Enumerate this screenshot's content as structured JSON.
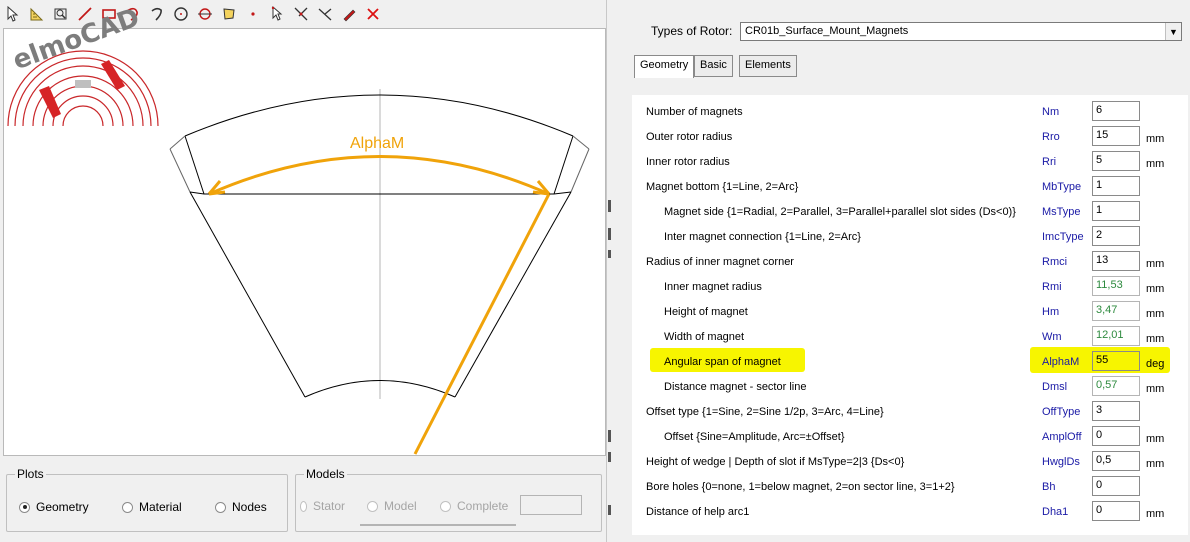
{
  "toolbar": {
    "icons": [
      "select-arrow-icon",
      "ruler-icon",
      "zoom-icon",
      "line-icon",
      "rectangle-icon",
      "arc-icon",
      "arc-reverse-icon",
      "circle-icon",
      "circle-point-icon",
      "polygon-icon",
      "point-icon",
      "pointer-icon",
      "multi-select-icon",
      "split-line-icon",
      "pencil-icon",
      "delete-x-icon"
    ]
  },
  "logo": {
    "text": "elmoCAD"
  },
  "geometry": {
    "annotation": "AlphaM",
    "accent_color": "#f0a30a"
  },
  "plots": {
    "title": "Plots",
    "options": [
      {
        "label": "Geometry",
        "selected": true
      },
      {
        "label": "Material",
        "selected": false
      },
      {
        "label": "Nodes",
        "selected": false
      }
    ]
  },
  "models": {
    "title": "Models",
    "options": [
      {
        "label": "Stator"
      },
      {
        "label": "Model"
      },
      {
        "label": "Complete"
      }
    ],
    "field_value": ""
  },
  "rotor": {
    "label": "Types of Rotor:",
    "selected": "CR01b_Surface_Mount_Magnets"
  },
  "tabs": [
    "Geometry",
    "Basic",
    "Elements"
  ],
  "parameters": [
    {
      "label": "Number of magnets",
      "sym": "Nm",
      "value": "6",
      "unit": "",
      "indent": false,
      "calc": false
    },
    {
      "label": "Outer rotor radius",
      "sym": "Rro",
      "value": "15",
      "unit": "mm",
      "indent": false,
      "calc": false
    },
    {
      "label": "Inner rotor radius",
      "sym": "Rri",
      "value": "5",
      "unit": "mm",
      "indent": false,
      "calc": false
    },
    {
      "label": "Magnet bottom {1=Line, 2=Arc}",
      "sym": "MbType",
      "value": "1",
      "unit": "",
      "indent": false,
      "calc": false
    },
    {
      "label": "Magnet side {1=Radial, 2=Parallel, 3=Parallel+parallel slot sides (Ds<0)}",
      "sym": "MsType",
      "value": "1",
      "unit": "",
      "indent": true,
      "calc": false
    },
    {
      "label": "Inter magnet connection {1=Line, 2=Arc}",
      "sym": "ImcType",
      "value": "2",
      "unit": "",
      "indent": true,
      "calc": false
    },
    {
      "label": "Radius of inner magnet corner",
      "sym": "Rmci",
      "value": "13",
      "unit": "mm",
      "indent": false,
      "calc": false
    },
    {
      "label": "Inner magnet radius",
      "sym": "Rmi",
      "value": "11,53",
      "unit": "mm",
      "indent": true,
      "calc": true
    },
    {
      "label": "Height of magnet",
      "sym": "Hm",
      "value": "3,47",
      "unit": "mm",
      "indent": true,
      "calc": true
    },
    {
      "label": "Width of magnet",
      "sym": "Wm",
      "value": "12,01",
      "unit": "mm",
      "indent": true,
      "calc": true
    },
    {
      "label": "Angular span of magnet",
      "sym": "AlphaM",
      "value": "55",
      "unit": "deg",
      "indent": true,
      "calc": false,
      "highlight": true
    },
    {
      "label": "Distance magnet - sector line",
      "sym": "Dmsl",
      "value": "0,57",
      "unit": "mm",
      "indent": true,
      "calc": true
    },
    {
      "label": "Offset type {1=Sine, 2=Sine 1/2p, 3=Arc, 4=Line}",
      "sym": "OffType",
      "value": "3",
      "unit": "",
      "indent": false,
      "calc": false
    },
    {
      "label": "Offset {Sine=Amplitude, Arc=±Offset}",
      "sym": "AmplOff",
      "value": "0",
      "unit": "mm",
      "indent": true,
      "calc": false
    },
    {
      "label": "Height of wedge | Depth of slot if MsType=2|3 {Ds<0}",
      "sym": "HwglDs",
      "value": "0,5",
      "unit": "mm",
      "indent": false,
      "calc": false
    },
    {
      "label": "Bore holes {0=none, 1=below magnet, 2=on sector line, 3=1+2}",
      "sym": "Bh",
      "value": "0",
      "unit": "",
      "indent": false,
      "calc": false
    },
    {
      "label": "Distance of help arc1",
      "sym": "Dha1",
      "value": "0",
      "unit": "mm",
      "indent": false,
      "calc": false
    }
  ],
  "highlight_color": "#f7f500"
}
